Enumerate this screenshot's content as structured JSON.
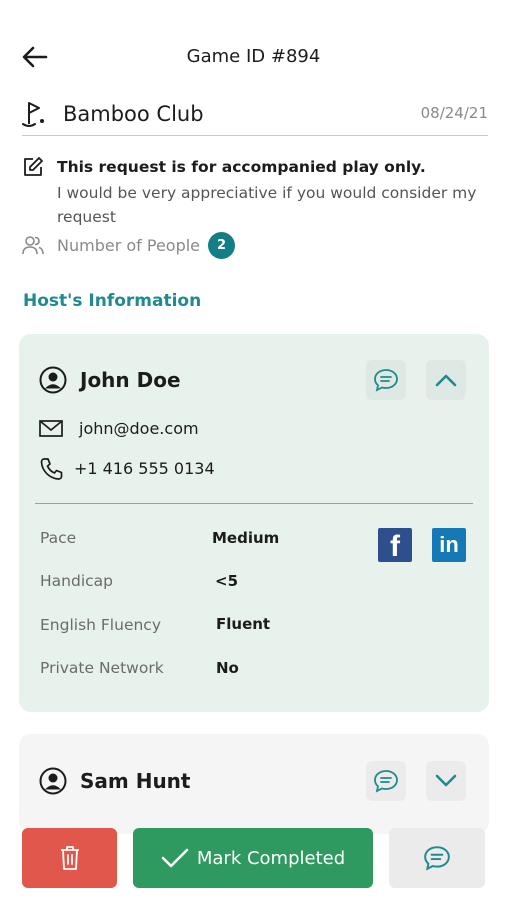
{
  "header": {
    "title": "Game ID #894"
  },
  "club": {
    "name": "Bamboo Club",
    "date": "08/24/21"
  },
  "request": {
    "title": "This request is for accompanied play only.",
    "message": "I would be very appreciative if you would consider my request"
  },
  "people": {
    "label": "Number of People",
    "count": "2"
  },
  "host_section": {
    "title": "Host's Information"
  },
  "hosts": [
    {
      "name": "John Doe",
      "email": "john@doe.com",
      "phone": "+1 416 555 0134",
      "expanded": true,
      "attributes": [
        {
          "label": "Pace",
          "value": "Medium"
        },
        {
          "label": "Handicap",
          "value": "<5"
        },
        {
          "label": "English Fluency",
          "value": "Fluent"
        },
        {
          "label": "Private Network",
          "value": "No"
        }
      ],
      "social": [
        "facebook-icon",
        "linkedin-icon"
      ]
    },
    {
      "name": "Sam Hunt",
      "expanded": false
    }
  ],
  "actions": {
    "complete_label": "Mark Completed"
  },
  "colors": {
    "teal": "#1f8a8f",
    "badge": "#147e86",
    "card_bg": "#e8f2ec",
    "delete": "#e1574c",
    "complete": "#2e9a5f",
    "facebook": "#2e4f8e",
    "linkedin": "#1479b5"
  }
}
